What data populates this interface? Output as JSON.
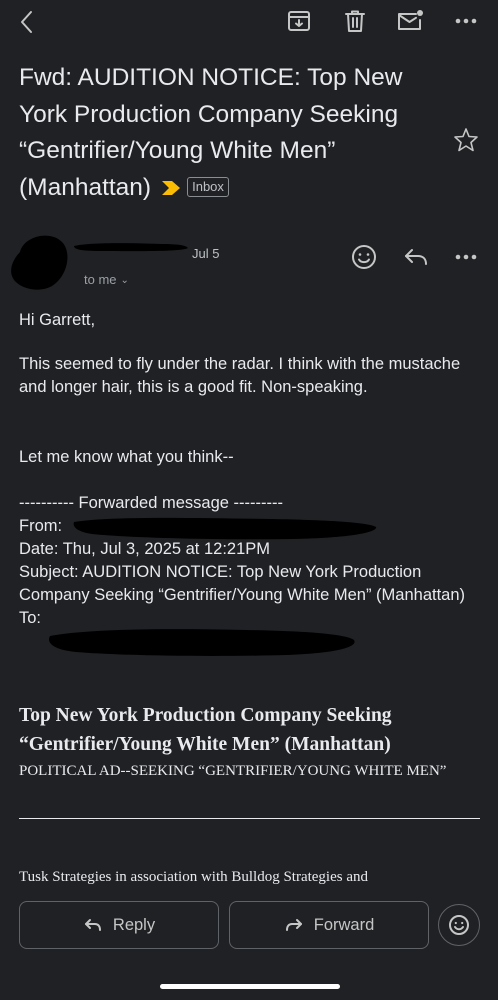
{
  "header": {
    "actions": [
      "back-icon",
      "archive-icon",
      "delete-icon",
      "mark-unread-icon",
      "more-icon"
    ]
  },
  "subject": {
    "text": "Fwd: AUDITION NOTICE: Top New York Production Company Seeking “Gentrifier/Young White Men” (Manhattan)",
    "label_chip": "Inbox",
    "important_color": "#fbbc04",
    "starred": false
  },
  "sender": {
    "date": "Jul 5",
    "recipient": "to me"
  },
  "message": {
    "greeting": "Hi Garrett,",
    "paragraph1": "This seemed to fly under the radar. I think with the mustache and longer hair, this is a good fit. Non-speaking.",
    "paragraph2": "Let me know what you think--",
    "forwarded_header": "---------- Forwarded message ---------",
    "from_label": "From:",
    "date_line": "Date: Thu, Jul 3, 2025 at 12:21PM",
    "subject_line": "Subject: AUDITION NOTICE: Top New York Production Company Seeking “Gentrifier/Young White Men” (Manhattan)",
    "to_label": "To:"
  },
  "forwarded_content": {
    "title": "Top New York Production Company Seeking “Gentrifier/Young White Men” (Manhattan)",
    "subtitle": "POLITICAL AD--SEEKING “GENTRIFIER/YOUNG WHITE MEN”",
    "intro": "Tusk Strategies in association with Bulldog Strategies and"
  },
  "actions": {
    "reply_label": "Reply",
    "forward_label": "Forward"
  },
  "colors": {
    "background": "#202124",
    "text": "#e8eaed",
    "secondary_text": "#9aa0a6",
    "important": "#fbbc04"
  }
}
